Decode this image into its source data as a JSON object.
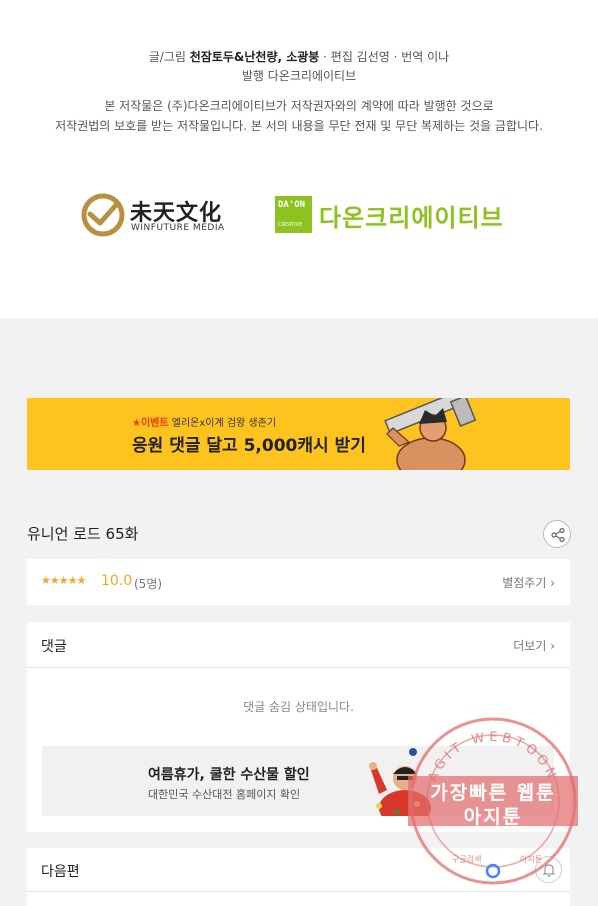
{
  "credits": {
    "writer_prefix": "글/그림 ",
    "writer_names": "천잠토두&난천량, 소광붕",
    "editor_translator": " · 편집 김선영 · 번역 이나",
    "publisher": "발행 다온크리에이티브",
    "copyright_1": "본 저작물은 (주)다온크리에이티브가 저작권자와의 계약에 따라 발행한 것으로",
    "copyright_2": "저작권법의 보호를 받는 저작물입니다. 본 서의 내용을 무단 전재 및 무단 복제하는 것을 금합니다."
  },
  "logos": {
    "winfuture_cn": "未天文化",
    "winfuture_en": "WINFUTURE  MEDIA",
    "daon_box_top": "DA'ON",
    "daon_box_bottom": "CREATIVE",
    "daon_name": "다온크리에이티브"
  },
  "banner": {
    "event_tag": "★이벤트",
    "event_title": " 엘리온x이계 검왕 생존기",
    "headline": "응원 댓글 달고 5,000캐시 받기"
  },
  "episode": {
    "title": "유니언 로드 65화"
  },
  "rating": {
    "stars": "★★★★★",
    "score": "10.0",
    "count": "(5명)",
    "rate_button": "별점주기 ›"
  },
  "comments": {
    "label": "댓글",
    "more_button": "더보기 ›",
    "hidden_message": "댓글 숨김 상태입니다."
  },
  "ad": {
    "headline": "여름휴가, 쿨한 수산물 할인",
    "subtext": "대한민국 수산대전 홈페이지 확인"
  },
  "next": {
    "label": "다음편"
  },
  "watermark": {
    "arc_text": "AGIT WEBTOON",
    "line1": "가장빠른 웹툰",
    "line2": "아지툰",
    "bottom_left": "구글검색",
    "bottom_right": "아지툰"
  },
  "colors": {
    "banner_bg": "#ffc31f",
    "rating_accent": "#f5a623",
    "daon_green": "#8dc21f",
    "stamp_red": "#e26e6e"
  }
}
